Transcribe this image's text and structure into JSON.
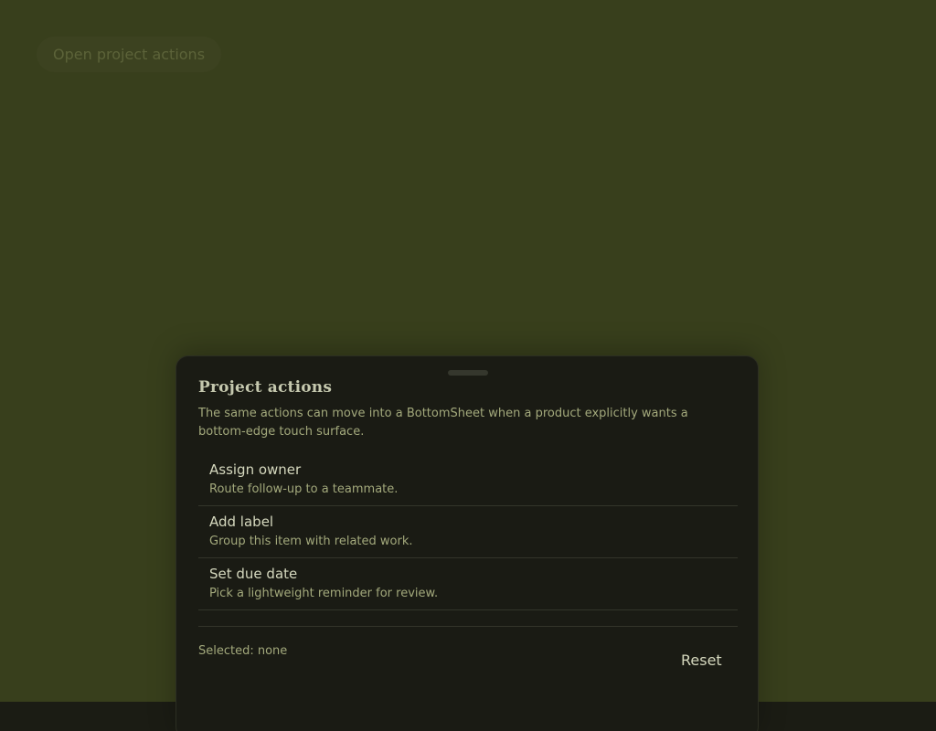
{
  "page": {
    "open_button_label": "Open project actions"
  },
  "sheet": {
    "title": "Project actions",
    "description": "The same actions can move into a BottomSheet when a product explicitly wants a bottom-edge touch surface.",
    "actions": [
      {
        "label": "Assign owner",
        "description": "Route follow-up to a teammate."
      },
      {
        "label": "Add label",
        "description": "Group this item with related work."
      },
      {
        "label": "Set due date",
        "description": "Pick a lightweight reminder for review."
      }
    ],
    "selected_text": "Selected: none",
    "reset_label": "Reset"
  },
  "colors": {
    "page_background": "#383f1c",
    "sheet_background": "#1a1b14",
    "primary_text": "#d5d8be",
    "secondary_text": "#a3a97c",
    "muted_button_text": "#5c6339"
  }
}
